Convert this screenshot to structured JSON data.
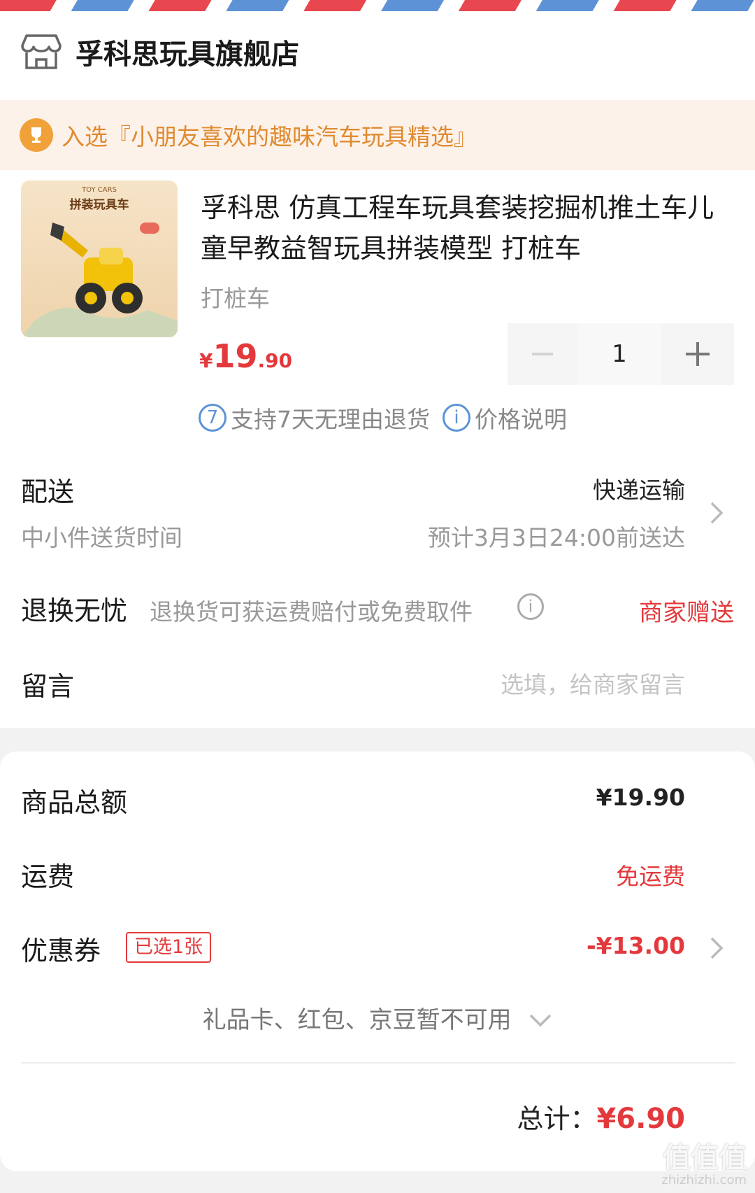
{
  "shop": {
    "name": "孚科思玩具旗舰店",
    "icon": "store-icon"
  },
  "promo": {
    "text": "入选『小朋友喜欢的趣味汽车玩具精选』",
    "icon": "trophy-icon"
  },
  "product": {
    "thumb_title": "拼装玩具车",
    "thumb_sub": "TOY CARS",
    "title": "孚科思 仿真工程车玩具套装挖掘机推土车儿童早教益智玩具拼装模型 打桩车",
    "variant": "打桩车",
    "price": {
      "currency": "¥",
      "integer": "19",
      "decimal": ".90"
    },
    "quantity": "1"
  },
  "services": {
    "badge_7": "7",
    "return_policy": "支持7天无理由退货",
    "badge_i": "i",
    "price_note": "价格说明"
  },
  "delivery": {
    "label": "配送",
    "method": "快递运输",
    "time_label": "中小件送货时间",
    "eta": "预计3月3日24:00前送达"
  },
  "returns": {
    "label": "退换无忧",
    "note": "退换货可获运费赔付或免费取件",
    "info_badge": "i",
    "value": "商家赠送"
  },
  "message": {
    "label": "留言",
    "placeholder": "选填，给商家留言"
  },
  "summary": {
    "goods_total_label": "商品总额",
    "goods_total": "¥19.90",
    "shipping_label": "运费",
    "shipping_value": "免运费",
    "coupon_label": "优惠券",
    "coupon_tag": "已选1张",
    "coupon_value": "-¥13.00",
    "unavailable": "礼品卡、红包、京豆暂不可用",
    "total_label": "总计：",
    "total_value": "¥6.90"
  },
  "watermark": {
    "logo": "值值值",
    "url": "zhizhizhi.com"
  },
  "colors": {
    "accent_red": "#e4393c",
    "promo_orange": "#e08a2f",
    "link_blue": "#5d93d6"
  }
}
